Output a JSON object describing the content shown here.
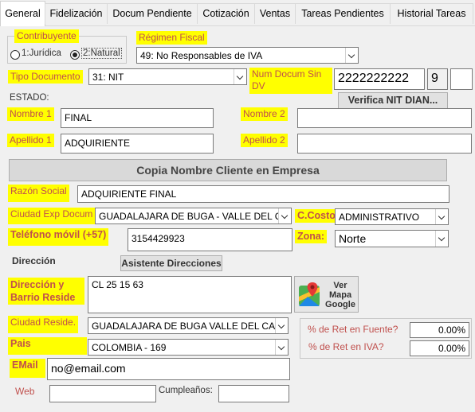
{
  "tabs": [
    "General",
    "Fidelización",
    "Docum Pendiente",
    "Cotización",
    "Ventas",
    "Tareas Pendientes",
    "Historial Tareas"
  ],
  "contribuyente": {
    "label": "Contribuyente",
    "opt1": "1:Jurídica",
    "opt2": "2:Natural",
    "selected": "2:Natural"
  },
  "regimen": {
    "label": "Régimen Fiscal",
    "value": "49: No Responsables de IVA"
  },
  "tipo_doc": {
    "label": "Tipo Documento",
    "value": "31: NIT"
  },
  "num_doc": {
    "label": "Num Docum Sin DV",
    "value": "2222222222",
    "dv": "9",
    "extra": ""
  },
  "estado": {
    "label": "ESTADO:"
  },
  "verifica_btn": "Verifica NIT DIAN...",
  "nombre1": {
    "label": "Nombre 1",
    "value": "FINAL"
  },
  "nombre2": {
    "label": "Nombre 2",
    "value": ""
  },
  "apellido1": {
    "label": "Apellido 1",
    "value": "ADQUIRIENTE"
  },
  "apellido2": {
    "label": "Apellido 2",
    "value": ""
  },
  "copia_btn": "Copia Nombre Cliente en Empresa",
  "razon": {
    "label": "Razón Social",
    "value": "ADQUIRIENTE  FINAL"
  },
  "ciudad_exp": {
    "label": "Ciudad Exp Docum",
    "value": "GUADALAJARA DE BUGA - VALLE DEL CAUCA"
  },
  "ccosto": {
    "label": "C.Costo",
    "value": "ADMINISTRATIVO"
  },
  "telefono": {
    "label": "Teléfono móvil (+57)",
    "value": "3154429923"
  },
  "zona": {
    "label": "Zona:",
    "value": "Norte"
  },
  "direccion_title": "Dirección",
  "asistente_btn": "Asistente Direcciones",
  "dir_barrio": {
    "label": "Dirección y Barrio Reside",
    "value": "CL 25 15 63"
  },
  "mapa_btn": {
    "l1": "Ver",
    "l2": "Mapa",
    "l3": "Google"
  },
  "ciudad_res": {
    "label": "Ciudad Reside.",
    "value": "GUADALAJARA DE BUGA  VALLE DEL CAUCA"
  },
  "pais": {
    "label": "Pais",
    "value": "COLOMBIA - 169"
  },
  "email": {
    "label": "EMail",
    "value": "no@email.com"
  },
  "web": {
    "label": "Web",
    "value": ""
  },
  "cumple": {
    "label": "Cumpleaños:",
    "value": ""
  },
  "ret_fuente": {
    "label": "% de Ret en Fuente?",
    "value": "0.00%"
  },
  "ret_iva": {
    "label": "% de Ret en IVA?",
    "value": "0.00%"
  }
}
